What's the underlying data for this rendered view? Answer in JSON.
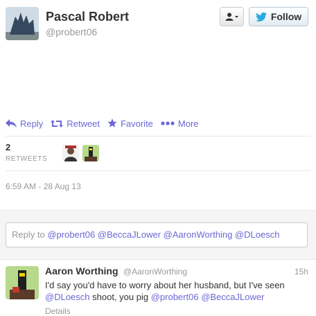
{
  "tweet": {
    "author_name": "Pascal Robert",
    "author_handle": "@probert06",
    "text": "",
    "timestamp": "6:59 AM - 28 Aug 13",
    "retweet_count": "2",
    "retweet_label": "RETWEETS"
  },
  "header": {
    "follow_label": "Follow"
  },
  "actions": {
    "reply": "Reply",
    "retweet": "Retweet",
    "favorite": "Favorite",
    "more": "More"
  },
  "reply_box": {
    "prefix": "Reply to",
    "mentions": "@probert06 @BeccaJLower @AaronWorthing @DLoesch"
  },
  "reply_tweet": {
    "author_name": "Aaron Worthing",
    "author_handle": "@AaronWorthing",
    "time": "15h",
    "text_1": "I'd say you'd have to worry about her husband, but I've seen",
    "mention_1": "@DLoesch",
    "text_2": "shoot, you pig",
    "mention_2": "@probert06",
    "mention_3": "@BeccaJLower",
    "details_label": "Details"
  },
  "colors": {
    "link": "#6d66d6",
    "muted": "#999999",
    "text": "#333333",
    "twitter_blue": "#2ba9e1"
  }
}
